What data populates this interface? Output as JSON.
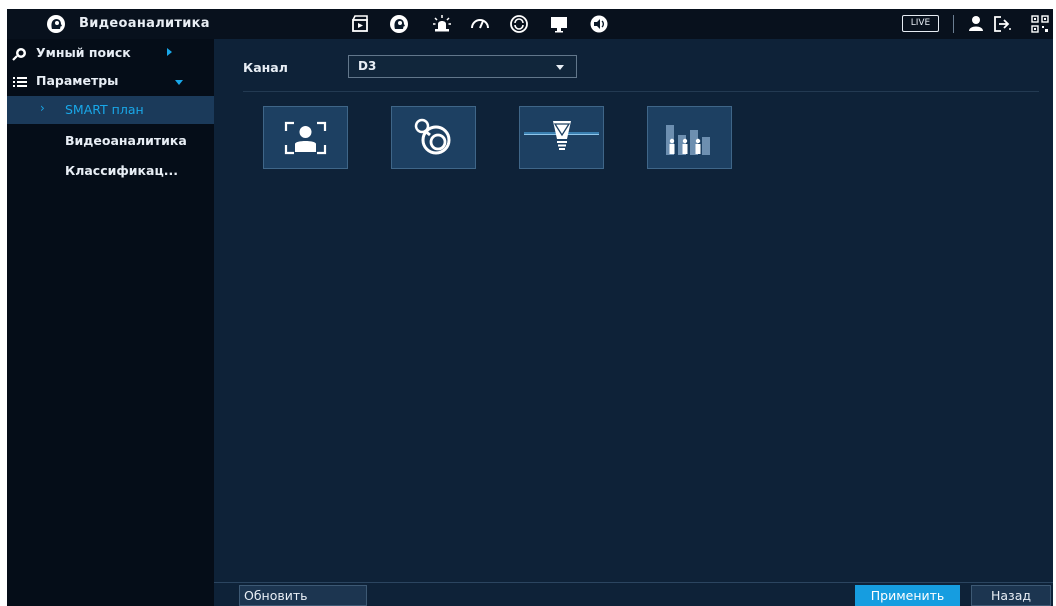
{
  "topbar": {
    "title": "Видеоаналитика",
    "app_icon": "head-analytics-icon",
    "icons": [
      "film-playback-icon",
      "head-analytics-icon",
      "alarm-icon",
      "gauge-icon",
      "sync-icon",
      "monitor-icon",
      "speaker-icon",
      "user-icon",
      "logout-icon",
      "qr-code-icon"
    ],
    "live_label": "LIVE"
  },
  "sidebar": {
    "items": [
      {
        "label": "Умный поиск",
        "icon": "smart-search-icon"
      },
      {
        "label": "Параметры",
        "icon": "list-icon"
      },
      {
        "label": "SMART план",
        "active": true
      },
      {
        "label": "Видеоаналитика"
      },
      {
        "label": "Классификац..."
      }
    ]
  },
  "main": {
    "channel_label": "Канал",
    "channel_value": "D3",
    "tiles": [
      "face-detection-icon",
      "camera-lens-icon",
      "lightbulb-icon",
      "people-counting-icon"
    ]
  },
  "footer": {
    "refresh_label": "Обновить",
    "apply_label": "Применить",
    "back_label": "Назад"
  },
  "colors": {
    "accent": "#169de0",
    "background": "#0e2238",
    "sidebar": "#050d18",
    "topbar": "#08111d"
  }
}
